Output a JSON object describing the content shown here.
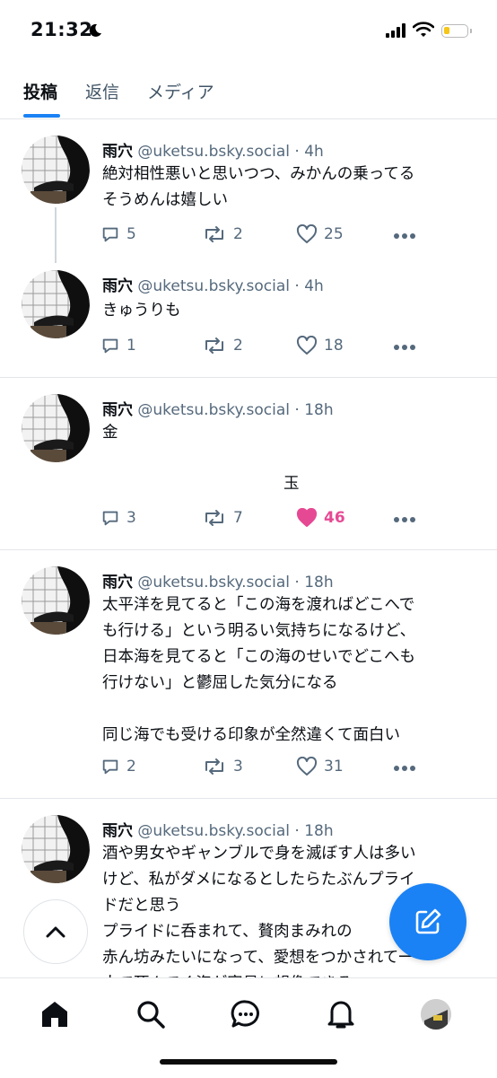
{
  "status": {
    "time": "21:32"
  },
  "tabs": [
    {
      "label": "投稿",
      "active": true
    },
    {
      "label": "返信",
      "active": false
    },
    {
      "label": "メディア",
      "active": false
    }
  ],
  "posts": [
    {
      "name": "雨穴",
      "handle": "@uketsu.bsky.social",
      "dot": " · ",
      "time": "4h",
      "text": "絶対相性悪いと思いつつ、みかんの乗ってる\nそうめんは嬉しい",
      "replies": "5",
      "reposts": "2",
      "likes": "25",
      "liked": false
    },
    {
      "name": "雨穴",
      "handle": "@uketsu.bsky.social",
      "dot": " · ",
      "time": "4h",
      "text": "きゅうりも",
      "replies": "1",
      "reposts": "2",
      "likes": "18",
      "liked": false
    },
    {
      "name": "雨穴",
      "handle": "@uketsu.bsky.social",
      "dot": " · ",
      "time": "18h",
      "text": "金",
      "text2": "玉",
      "replies": "3",
      "reposts": "7",
      "likes": "46",
      "liked": true
    },
    {
      "name": "雨穴",
      "handle": "@uketsu.bsky.social",
      "dot": " · ",
      "time": "18h",
      "text": "太平洋を見てると「この海を渡ればどこへで\nも行ける」という明るい気持ちになるけど、\n日本海を見てると「この海のせいでどこへも\n行けない」と鬱屈した気分になる\n\n同じ海でも受ける印象が全然違くて面白い",
      "replies": "2",
      "reposts": "3",
      "likes": "31",
      "liked": false
    },
    {
      "name": "雨穴",
      "handle": "@uketsu.bsky.social",
      "dot": " · ",
      "time": "18h",
      "text": "酒や男女やギャンブルで身を滅ぼす人は多い\nけど、私がダメになるとしたらたぶんプライ\nドだと思う\nプライドに呑まれて、贅肉まみれの\n赤ん坊みたいになって、愛想をつかされて一\n人で死んでく姿が容易に想像できる"
    }
  ],
  "colors": {
    "accent": "#1a82f5",
    "like": "#e64994",
    "muted": "#55697c"
  },
  "icons": [
    "moon-icon",
    "signal-icon",
    "wifi-icon",
    "battery-icon",
    "reply-icon",
    "repost-icon",
    "heart-icon",
    "more-icon",
    "chevron-up-icon",
    "compose-icon",
    "home-icon",
    "search-icon",
    "chat-icon",
    "bell-icon"
  ]
}
